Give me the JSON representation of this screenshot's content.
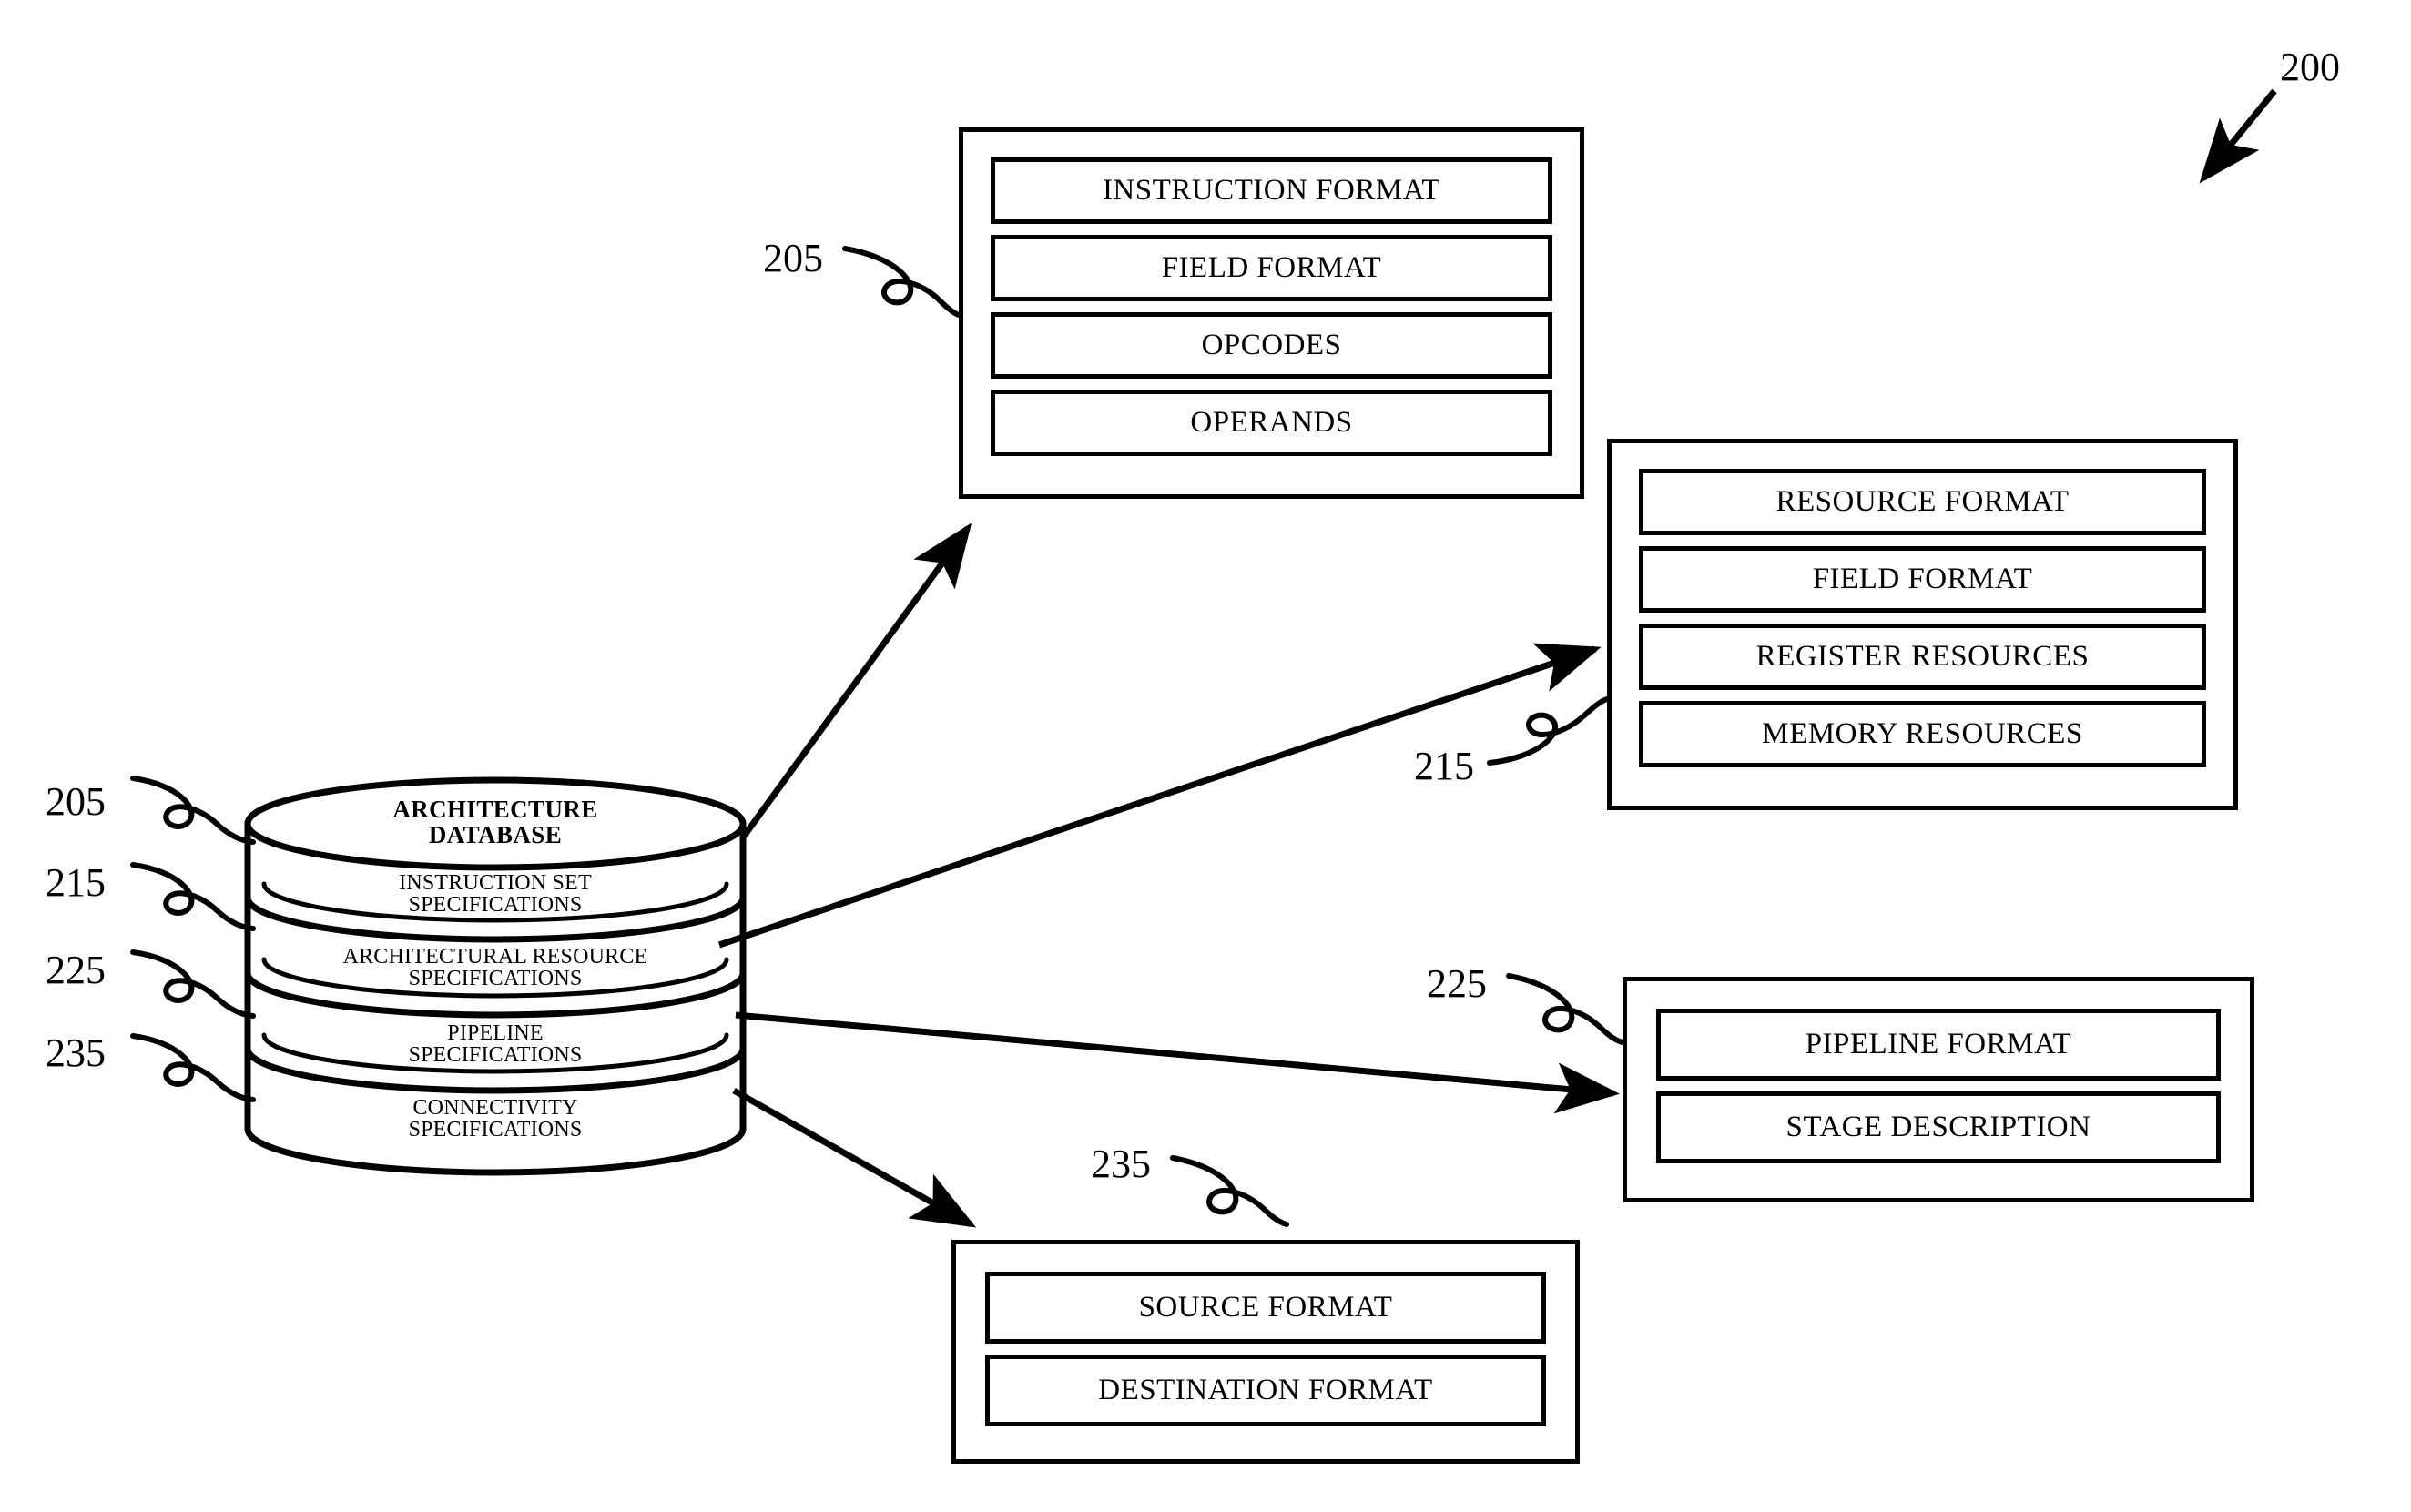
{
  "figure": {
    "number": "200",
    "title": "Architecture Database Block Diagram"
  },
  "database": {
    "title": "ARCHITECTURE\nDATABASE",
    "title_line1": "ARCHITECTURE",
    "title_line2": "DATABASE",
    "bands": [
      {
        "ref": "205",
        "line1": "INSTRUCTION SET",
        "line2": "SPECIFICATIONS"
      },
      {
        "ref": "215",
        "line1": "ARCHITECTURAL RESOURCE",
        "line2": "SPECIFICATIONS"
      },
      {
        "ref": "225",
        "line1": "PIPELINE",
        "line2": "SPECIFICATIONS"
      },
      {
        "ref": "235",
        "line1": "CONNECTIVITY",
        "line2": "SPECIFICATIONS"
      }
    ]
  },
  "boxes": {
    "instruction_set": {
      "ref": "205",
      "items": [
        "INSTRUCTION FORMAT",
        "FIELD FORMAT",
        "OPCODES",
        "OPERANDS"
      ]
    },
    "architectural_resource": {
      "ref": "215",
      "items": [
        "RESOURCE FORMAT",
        "FIELD FORMAT",
        "REGISTER RESOURCES",
        "MEMORY RESOURCES"
      ]
    },
    "pipeline": {
      "ref": "225",
      "items": [
        "PIPELINE FORMAT",
        "STAGE DESCRIPTION"
      ]
    },
    "connectivity": {
      "ref": "235",
      "items": [
        "SOURCE FORMAT",
        "DESTINATION FORMAT"
      ]
    }
  },
  "reference_numerals": {
    "figure": "200",
    "left_column": [
      "205",
      "215",
      "225",
      "235"
    ],
    "callouts": {
      "instruction_set": "205",
      "architectural_resource": "215",
      "pipeline": "225",
      "connectivity": "235"
    }
  },
  "style": {
    "line_color": "#000000",
    "background": "#ffffff"
  }
}
